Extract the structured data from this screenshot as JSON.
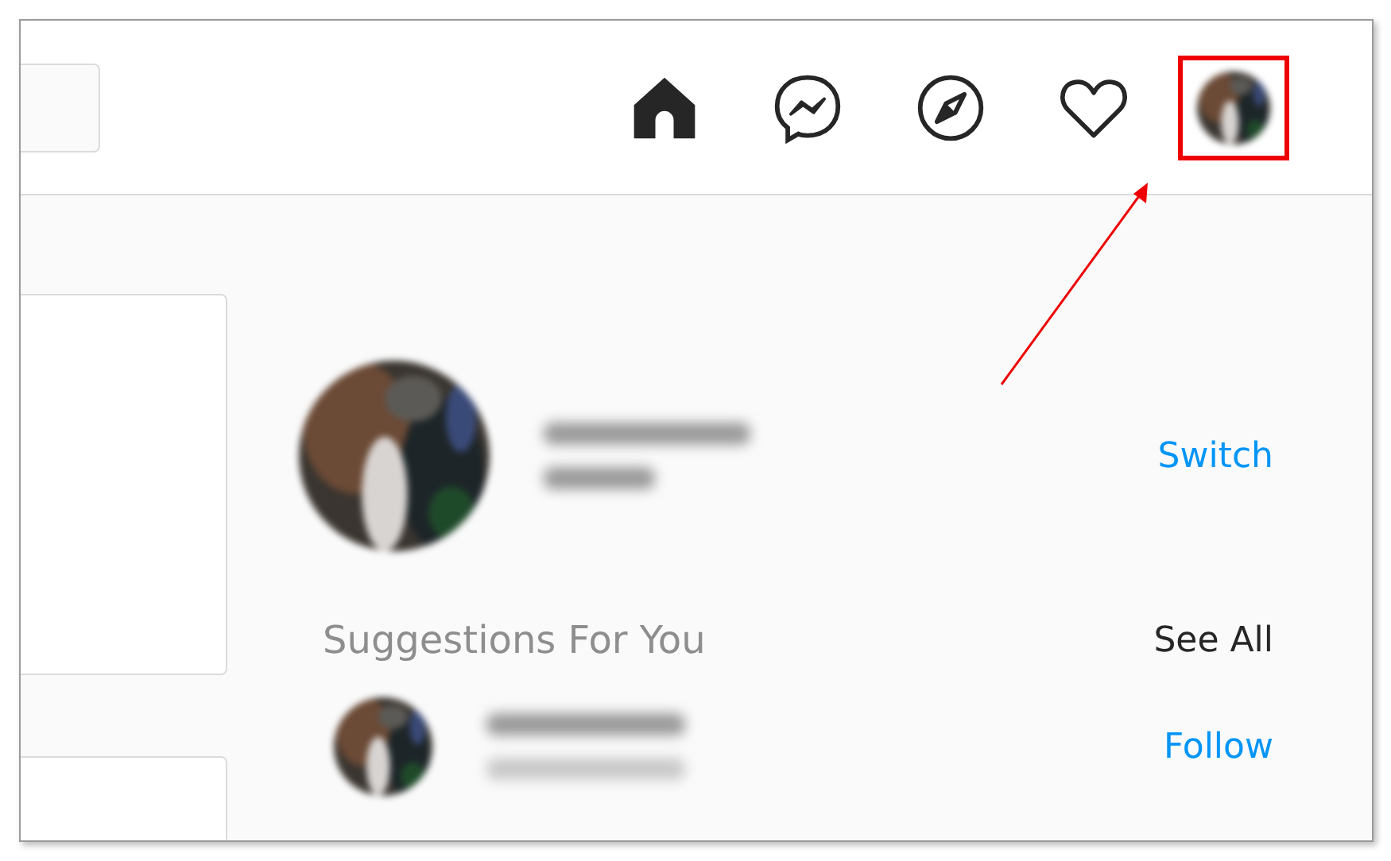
{
  "header": {
    "search": {
      "kind": "field"
    },
    "nav": [
      {
        "kind": "home",
        "highlighted": false
      },
      {
        "kind": "messenger",
        "highlighted": false
      },
      {
        "kind": "explore",
        "highlighted": false
      },
      {
        "kind": "activity",
        "highlighted": false
      },
      {
        "kind": "profile",
        "highlighted": true
      }
    ]
  },
  "account": {
    "action": "Switch"
  },
  "suggestions": {
    "title": "Suggestions For You",
    "see_all": "See All",
    "items": [
      {
        "action": "Follow"
      }
    ]
  }
}
